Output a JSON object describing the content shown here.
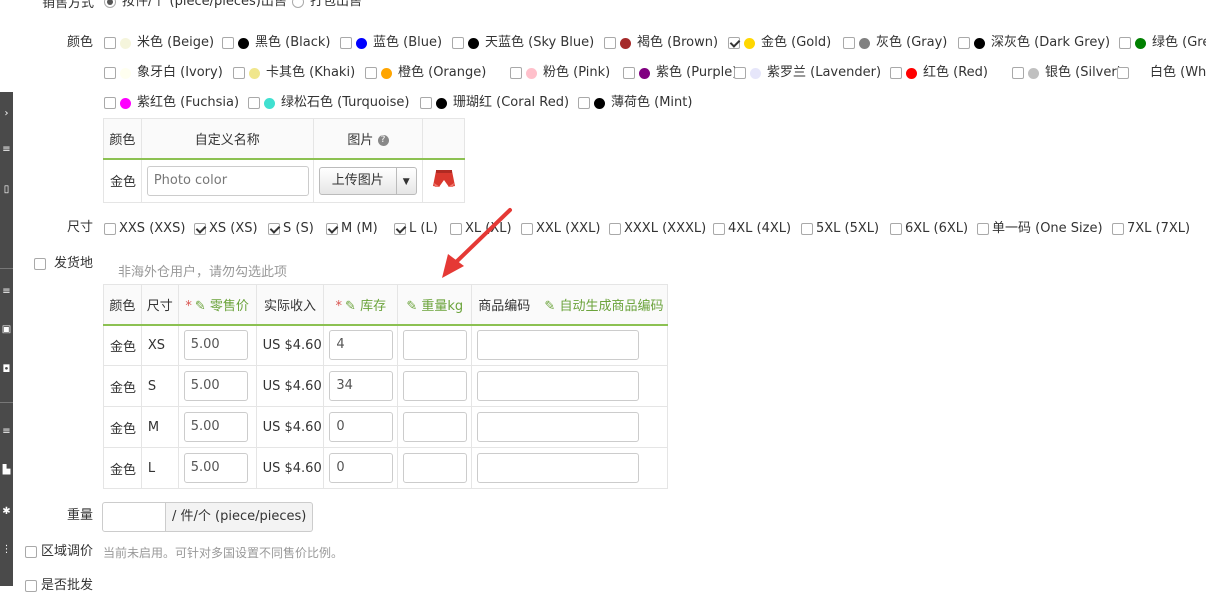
{
  "sale_method": {
    "label": "销售方式",
    "options": [
      {
        "label": "按件/个 (piece/pieces)出售",
        "checked": true
      },
      {
        "label": "打包出售",
        "checked": false
      }
    ]
  },
  "color": {
    "label": "颜色",
    "options": [
      {
        "label": "米色 (Beige)",
        "swatch": "#f5f5dc",
        "checked": false
      },
      {
        "label": "黑色 (Black)",
        "swatch": "#000000",
        "checked": false
      },
      {
        "label": "蓝色 (Blue)",
        "swatch": "#0000ff",
        "checked": false
      },
      {
        "label": "天蓝色 (Sky Blue)",
        "swatch": "#000000",
        "checked": false
      },
      {
        "label": "褐色 (Brown)",
        "swatch": "#a52a2a",
        "checked": false
      },
      {
        "label": "金色 (Gold)",
        "swatch": "#ffd700",
        "checked": true
      },
      {
        "label": "灰色 (Gray)",
        "swatch": "#808080",
        "checked": false
      },
      {
        "label": "深灰色 (Dark Grey)",
        "swatch": "#000000",
        "checked": false
      },
      {
        "label": "绿色 (Gre",
        "swatch": "#008000",
        "checked": false
      },
      {
        "label": "象牙白 (Ivory)",
        "swatch": "#fffff0",
        "checked": false
      },
      {
        "label": "卡其色 (Khaki)",
        "swatch": "#f0e68c",
        "checked": false
      },
      {
        "label": "橙色 (Orange)",
        "swatch": "#ffa500",
        "checked": false
      },
      {
        "label": "粉色 (Pink)",
        "swatch": "#ffc0cb",
        "checked": false
      },
      {
        "label": "紫色 (Purple)",
        "swatch": "#800080",
        "checked": false
      },
      {
        "label": "紫罗兰 (Lavender)",
        "swatch": "#e6e6fa",
        "checked": false
      },
      {
        "label": "红色 (Red)",
        "swatch": "#ff0000",
        "checked": false
      },
      {
        "label": "银色 (Silver)",
        "swatch": "#c0c0c0",
        "checked": false
      },
      {
        "label": "白色 (Whi",
        "swatch": "#ffffff",
        "checked": false
      },
      {
        "label": "紫红色 (Fuchsia)",
        "swatch": "#ff00ff",
        "checked": false
      },
      {
        "label": "绿松石色 (Turquoise)",
        "swatch": "#40e0d0",
        "checked": false
      },
      {
        "label": "珊瑚红 (Coral Red)",
        "swatch": "#000000",
        "checked": false
      },
      {
        "label": "薄荷色 (Mint)",
        "swatch": "#000000",
        "checked": false
      }
    ]
  },
  "color_table": {
    "headers": {
      "color": "颜色",
      "custom_name": "自定义名称",
      "image": "图片"
    },
    "row": {
      "color": "金色",
      "custom_name_placeholder": "Photo color",
      "upload_label": "上传图片"
    }
  },
  "size": {
    "label": "尺寸",
    "options": [
      {
        "label": "XXS (XXS)",
        "checked": false
      },
      {
        "label": "XS (XS)",
        "checked": true
      },
      {
        "label": "S (S)",
        "checked": true
      },
      {
        "label": "M (M)",
        "checked": true
      },
      {
        "label": "L (L)",
        "checked": true
      },
      {
        "label": "XL (XL)",
        "checked": false
      },
      {
        "label": "XXL (XXL)",
        "checked": false
      },
      {
        "label": "XXXL (XXXL)",
        "checked": false
      },
      {
        "label": "4XL (4XL)",
        "checked": false
      },
      {
        "label": "5XL (5XL)",
        "checked": false
      },
      {
        "label": "6XL (6XL)",
        "checked": false
      },
      {
        "label": "单一码 (One Size)",
        "checked": false
      },
      {
        "label": "7XL (7XL)",
        "checked": false
      }
    ]
  },
  "ship_from": {
    "label": "发货地",
    "hint": "非海外仓用户，请勿勾选此项",
    "checked": false
  },
  "sku_table": {
    "headers": {
      "color": "颜色",
      "size": "尺寸",
      "retail_price": "零售价",
      "actual_income": "实际收入",
      "stock": "库存",
      "weight": "重量kg",
      "product_code": "商品编码",
      "auto_code": "自动生成商品编码"
    },
    "rows": [
      {
        "color": "金色",
        "size": "XS",
        "price": "5.00",
        "income": "US $4.60",
        "stock": "4",
        "weight": "",
        "code": ""
      },
      {
        "color": "金色",
        "size": "S",
        "price": "5.00",
        "income": "US $4.60",
        "stock": "34",
        "weight": "",
        "code": ""
      },
      {
        "color": "金色",
        "size": "M",
        "price": "5.00",
        "income": "US $4.60",
        "stock": "0",
        "weight": "",
        "code": ""
      },
      {
        "color": "金色",
        "size": "L",
        "price": "5.00",
        "income": "US $4.60",
        "stock": "0",
        "weight": "",
        "code": ""
      }
    ]
  },
  "weight": {
    "label": "重量",
    "value": "",
    "unit": "/ 件/个 (piece/pieces)"
  },
  "regional_pricing": {
    "label": "区域调价",
    "hint": "当前未启用。可针对多国设置不同售价比例。",
    "checked": false
  },
  "wholesale": {
    "label": "是否批发",
    "checked": false
  },
  "annotation": {
    "arrow_color": "#e53935"
  }
}
